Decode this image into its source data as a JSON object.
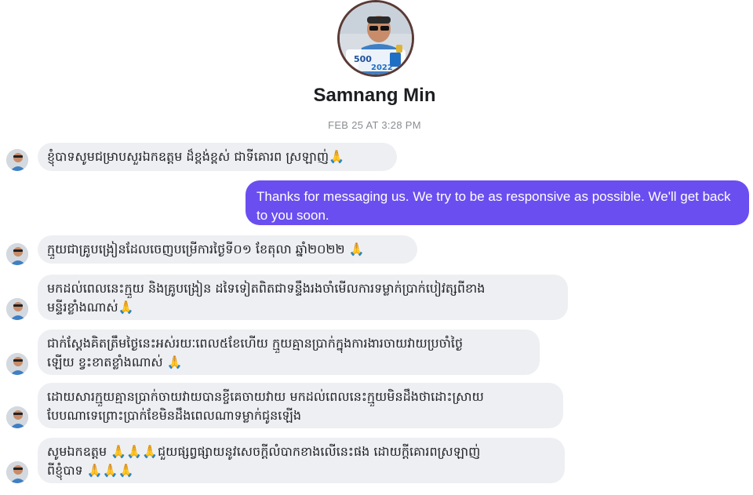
{
  "profile": {
    "name": "Samnang Min",
    "avatar_badge_text": "500",
    "avatar_badge_year": "2022"
  },
  "conversation": {
    "timestamp": "FEB 25 AT 3:28 PM",
    "messages": [
      {
        "from": "contact",
        "text": "ខ្ញុំបាទសូមជម្រាបសួរឯកឧត្តម ដ៏ខ្ពង់ខ្ពស់ ជាទីគោរព ស្រឡាញ់🙏"
      },
      {
        "from": "page",
        "text": "Thanks for messaging us. We try to be as responsive as possible. We'll get back to you soon."
      },
      {
        "from": "contact",
        "text": "ក្មួយជាគ្រូបង្រៀនដែលចេញបម្រើការថ្ងៃទី០១ ខែតុលា ឆ្នាំ២០២២ 🙏"
      },
      {
        "from": "contact",
        "text": "មកដល់ពេលនេះក្មួយ និងគ្រូបង្រៀន ដទៃទៀតពិតជាទន្ទឹងរងចាំមើលការទម្លាក់ប្រាក់បៀវត្សពីខាង\nមន្ទីរខ្លាំងណាស់🙏"
      },
      {
        "from": "contact",
        "text": "ជាក់ស្តែងគិតត្រឹមថ្ងៃនេះអស់រយៈពេល៥ខែហើយ ក្មួយគ្មានប្រាក់ក្នុងការងារចាយវាយប្រចាំថ្ងៃ\nឡើយ ខ្វះខាតខ្លាំងណាស់ 🙏"
      },
      {
        "from": "contact",
        "text": "ដោយសារក្មួយគ្មានប្រាក់ចាយវាយបានខ្ចីគេចាយវាយ មកដល់ពេលនេះក្មួយមិនដឹងថាដោះស្រាយ\nបែបណាទេព្រោះប្រាក់ខែមិនដឹងពេលណាទម្លាក់ជូនឡើង"
      },
      {
        "from": "contact",
        "text": "សូមឯកឧត្តម 🙏🙏🙏ជួយផ្សព្វផ្សាយនូវសេចក្តីលំបាកខាងលើនេះផង ដោយក្តីគោរពស្រឡាញ់\nពីខ្ញុំបាទ 🙏🙏🙏"
      }
    ]
  }
}
